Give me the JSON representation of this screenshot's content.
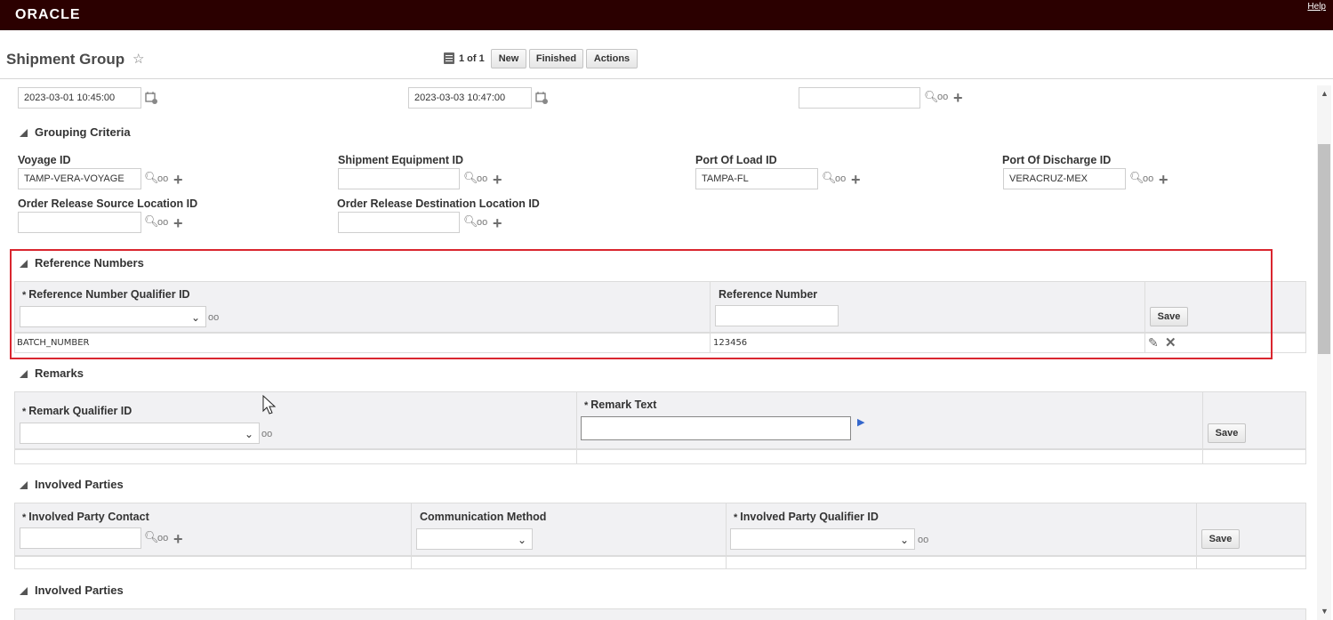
{
  "app": {
    "brand": "ORACLE",
    "help_label": "Help"
  },
  "page": {
    "title": "Shipment Group"
  },
  "pager": {
    "text": "1 of 1"
  },
  "toolbar": {
    "new_label": "New",
    "finished_label": "Finished",
    "actions_label": "Actions"
  },
  "dates": {
    "start_value": "2023-03-01 10:45:00",
    "end_value": "2023-03-03 10:47:00",
    "third_value": ""
  },
  "grouping": {
    "header": "Grouping Criteria",
    "voyage_label": "Voyage ID",
    "voyage_value": "TAMP-VERA-VOYAGE",
    "equipment_label": "Shipment Equipment ID",
    "equipment_value": "",
    "pol_label": "Port Of Load ID",
    "pol_value": "TAMPA-FL",
    "pod_label": "Port Of Discharge ID",
    "pod_value": "VERACRUZ-MEX",
    "src_label": "Order Release Source Location ID",
    "src_value": "",
    "dest_label": "Order Release Destination Location ID",
    "dest_value": ""
  },
  "refnums": {
    "header": "Reference Numbers",
    "col_qualifier": "Reference Number Qualifier ID",
    "col_number": "Reference Number",
    "save_label": "Save",
    "rows": [
      {
        "qualifier": "BATCH_NUMBER",
        "number": "123456"
      }
    ]
  },
  "remarks": {
    "header": "Remarks",
    "col_qualifier": "Remark Qualifier ID",
    "col_text": "Remark Text",
    "save_label": "Save"
  },
  "parties": {
    "header": "Involved Parties",
    "col_contact": "Involved Party Contact",
    "col_method": "Communication Method",
    "col_qualifier": "Involved Party Qualifier ID",
    "save_label": "Save"
  },
  "parties2": {
    "header": "Involved Parties"
  },
  "colors": {
    "topbar": "#2b0000",
    "highlight": "#d9262f"
  }
}
